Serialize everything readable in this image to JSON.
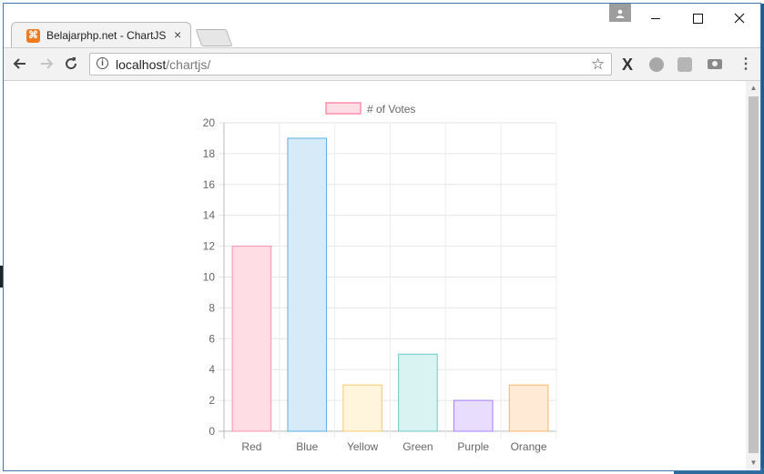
{
  "browser": {
    "tab_title": "Belajarphp.net - ChartJS",
    "tab_close": "×",
    "url_host": "localhost",
    "url_path": "/chartjs/",
    "profile_icon": "person-icon"
  },
  "icons": {
    "back": "←",
    "forward": "→",
    "reload": "↻",
    "star": "☆",
    "ext_x": "X",
    "menu": "⋮",
    "info": "i",
    "favicon": "⌘"
  },
  "chart_data": {
    "type": "bar",
    "categories": [
      "Red",
      "Blue",
      "Yellow",
      "Green",
      "Purple",
      "Orange"
    ],
    "series": [
      {
        "name": "# of Votes",
        "values": [
          12,
          19,
          3,
          5,
          2,
          3
        ]
      }
    ],
    "ylim": [
      0,
      20
    ],
    "yticks": [
      0,
      2,
      4,
      6,
      8,
      10,
      12,
      14,
      16,
      18,
      20
    ],
    "legend_position": "top",
    "grid": true,
    "colors": {
      "fill": [
        "#ffdde4",
        "#d6eaf8",
        "#fff4dc",
        "#d9f2f2",
        "#e9ddfd",
        "#ffead6"
      ],
      "border": [
        "#ff8fab",
        "#5aaee5",
        "#f5ca6e",
        "#6cc8c8",
        "#a87dfb",
        "#f5b56c"
      ]
    }
  }
}
